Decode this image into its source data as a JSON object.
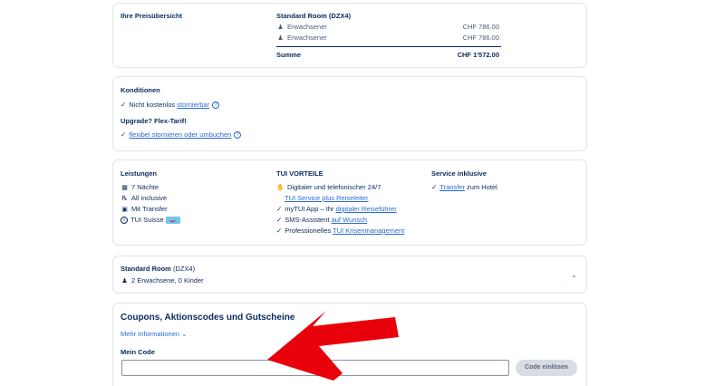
{
  "price": {
    "heading": "Ihre Preisübersicht",
    "room_title": "Standard Room (DZX4)",
    "lines": [
      {
        "label": "Erwachsener",
        "amount": "CHF 786.00"
      },
      {
        "label": "Erwachsener",
        "amount": "CHF 786.00"
      }
    ],
    "total_label": "Summe",
    "total_amount": "CHF 1'572.00"
  },
  "conditions": {
    "heading": "Konditionen",
    "free_cancel_prefix": "Nicht kostenlos",
    "free_cancel_link": "stornierbar",
    "upgrade_heading": "Upgrade? Flex-Tarif!",
    "flex_link": "flexibel stornieren oder umbuchen"
  },
  "services": {
    "leistungen_heading": "Leistungen",
    "leistungen": [
      "7 Nächte",
      "All inclusive",
      "Mit Transfer",
      "TUI Suisse"
    ],
    "vorteile_heading": "TUI VORTEILE",
    "vorteile_1": "Digitaler und telefonischer 24/7",
    "vorteile_1_link": "TUI Service plus Reiseleiter",
    "vorteile_2_prefix": "myTUI App – Ihr",
    "vorteile_2_link": "digitaler Reiseführer",
    "vorteile_3_prefix": "SMS-Assistent",
    "vorteile_3_link": "auf Wunsch",
    "vorteile_4_prefix": "Professionelles",
    "vorteile_4_link": "TUI Krisenmanagement",
    "service_heading": "Service inklusive",
    "service_link": "Transfer",
    "service_suffix": "zum Hotel"
  },
  "room": {
    "title_bold": "Standard Room",
    "title_code": "(DZX4)",
    "occupancy": "2 Erwachsene, 0 Kinder"
  },
  "coupon": {
    "heading": "Coupons, Aktionscodes und Gutscheine",
    "more_info": "Mehr Informationen",
    "field_label": "Mein Code",
    "input_value": "",
    "button_label": "Code einlösen"
  },
  "colors": {
    "accent": "#2a6ad6",
    "text": "#092a5e",
    "annotation_arrow": "#e8000b"
  }
}
